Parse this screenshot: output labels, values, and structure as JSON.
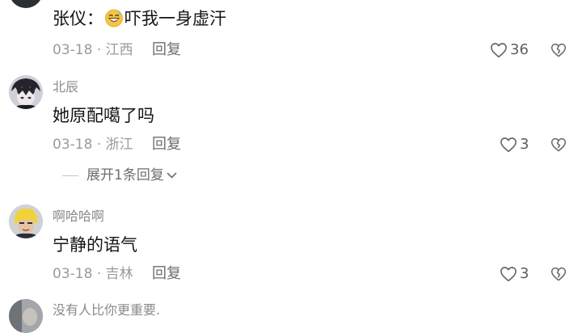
{
  "comments": [
    {
      "username": "",
      "text_before": "张仪：",
      "emoji": "grin-sweat-emoji",
      "text_after": "吓我一身虚汗",
      "date": "03-18",
      "sep": "·",
      "location": "江西",
      "reply": "回复",
      "likes": "36"
    },
    {
      "username": "北辰",
      "text": "她原配噶了吗",
      "date": "03-18",
      "sep": "·",
      "location": "浙江",
      "reply": "回复",
      "likes": "3"
    },
    {
      "username": "啊哈哈啊",
      "text": "宁静的语气",
      "date": "03-18",
      "sep": "·",
      "location": "吉林",
      "reply": "回复",
      "likes": "3"
    },
    {
      "username": "没有人比你更重要."
    }
  ],
  "expand_replies": "展开1条回复",
  "colors": {
    "text": "#141414",
    "muted": "#9a9a9a",
    "reply": "#6e6e6e"
  }
}
